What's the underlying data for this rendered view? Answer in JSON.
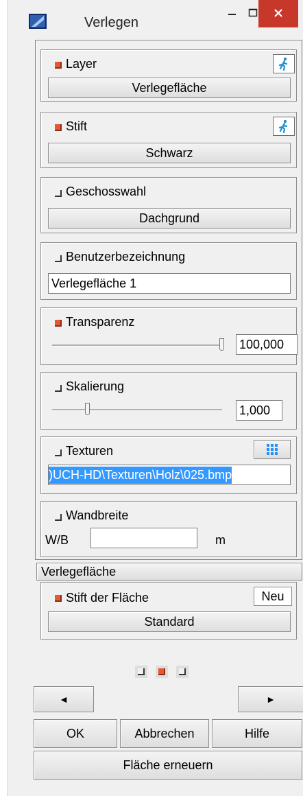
{
  "window": {
    "title": "Verlegen"
  },
  "layer": {
    "label": "Layer",
    "value": "Verlegefläche",
    "checked": true
  },
  "stift": {
    "label": "Stift",
    "value": "Schwarz",
    "checked": true
  },
  "geschoss": {
    "label": "Geschosswahl",
    "value": "Dachgrund",
    "checked": false
  },
  "benutzer": {
    "label": "Benutzerbezeichnung",
    "value": "Verlegefläche 1",
    "checked": false
  },
  "transparenz": {
    "label": "Transparenz",
    "value": "100,000",
    "slider_fraction": 1.0,
    "checked": true
  },
  "skalierung": {
    "label": "Skalierung",
    "value": "1,000",
    "slider_fraction": 0.2,
    "checked": false
  },
  "texturen": {
    "label": "Texturen",
    "value": ")UCH-HD\\Texturen\\Holz\\025.bmp",
    "checked": false
  },
  "wandbreite": {
    "label": "Wandbreite",
    "prefix": "W/B",
    "value": "",
    "unit": "m",
    "checked": false
  },
  "flaeche_section": {
    "title": "Verlegefläche"
  },
  "stift_flaeche": {
    "label": "Stift der Fläche",
    "new_label": "Neu",
    "value": "Standard",
    "checked": true
  },
  "pager": {
    "states": [
      false,
      true,
      false
    ]
  },
  "nav": {
    "prev": "◄",
    "next": "►"
  },
  "buttons": {
    "ok": "OK",
    "cancel": "Abbrechen",
    "help": "Hilfe",
    "renew": "Fläche erneuern"
  },
  "colors": {
    "accent_on": "#e8582f",
    "close_red": "#c7382b",
    "selection": "#3399ff"
  }
}
